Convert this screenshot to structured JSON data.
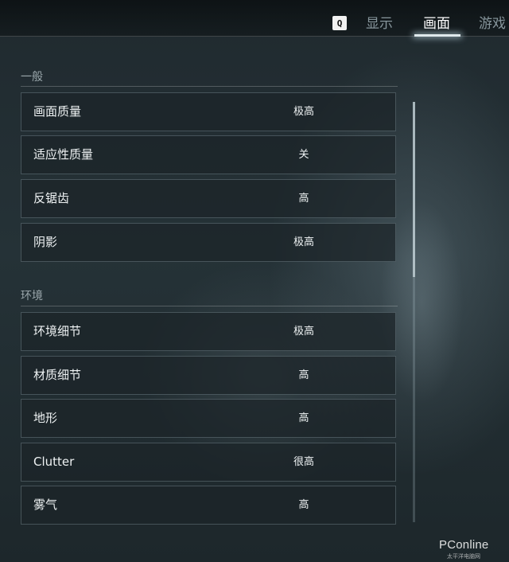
{
  "tabs": {
    "key_hint": "Q",
    "display": "显示",
    "graphics": "画面",
    "game": "游戏"
  },
  "sections": {
    "general": {
      "title": "一般",
      "rows": [
        {
          "label": "画面质量",
          "value": "极高"
        },
        {
          "label": "适应性质量",
          "value": "关"
        },
        {
          "label": "反锯齿",
          "value": "高"
        },
        {
          "label": "阴影",
          "value": "极高"
        }
      ]
    },
    "environment": {
      "title": "环境",
      "rows": [
        {
          "label": "环境细节",
          "value": "极高"
        },
        {
          "label": "材质细节",
          "value": "高"
        },
        {
          "label": "地形",
          "value": "高"
        },
        {
          "label": "Clutter",
          "value": "很高"
        },
        {
          "label": "雾气",
          "value": "高"
        }
      ]
    }
  },
  "watermark": {
    "brand": "PConline",
    "sub": "太平洋电脑网"
  }
}
